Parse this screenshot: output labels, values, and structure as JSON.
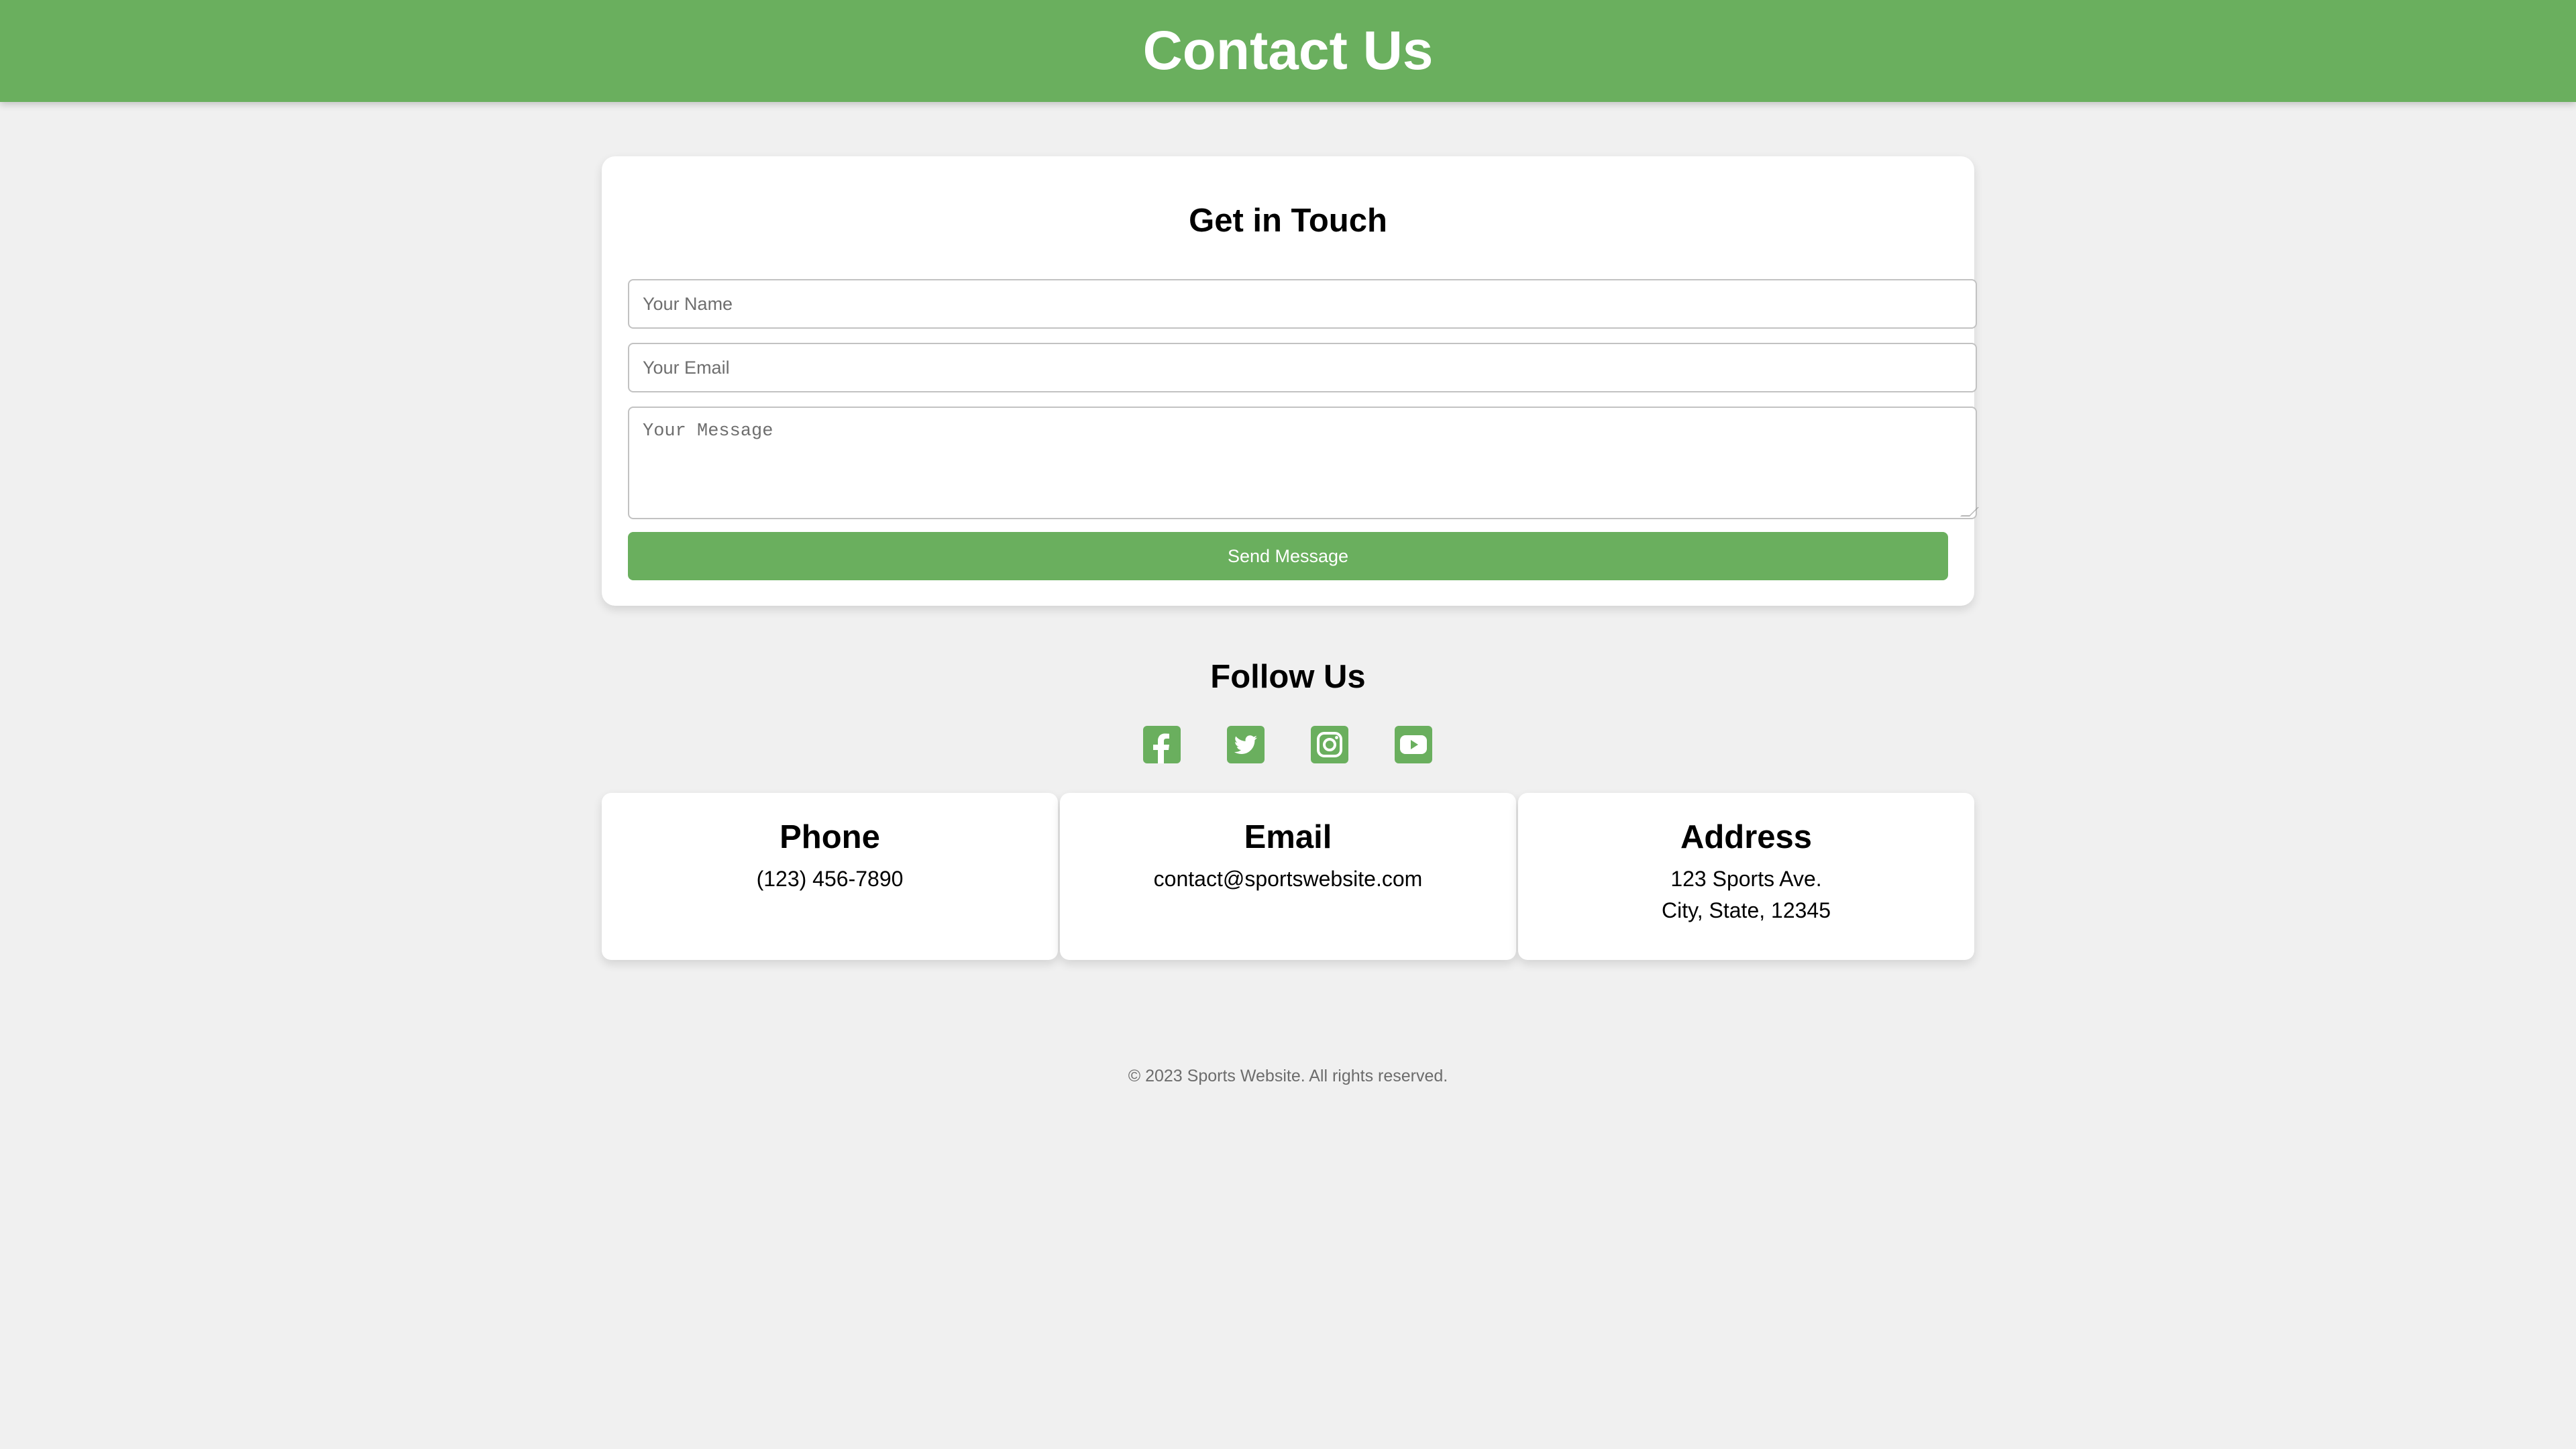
{
  "header": {
    "title": "Contact Us"
  },
  "form": {
    "title": "Get in Touch",
    "name_placeholder": "Your Name",
    "email_placeholder": "Your Email",
    "message_placeholder": "Your Message",
    "submit_label": "Send Message"
  },
  "follow": {
    "title": "Follow Us",
    "icons": [
      "facebook-icon",
      "twitter-icon",
      "instagram-icon",
      "youtube-icon"
    ]
  },
  "info": {
    "phone": {
      "title": "Phone",
      "value": "(123) 456-7890"
    },
    "email": {
      "title": "Email",
      "value": "contact@sportswebsite.com"
    },
    "address": {
      "title": "Address",
      "line1": "123 Sports Ave.",
      "line2": "City, State, 12345"
    }
  },
  "footer": {
    "text": "© 2023 Sports Website. All rights reserved."
  },
  "colors": {
    "brand_green": "#6aaf5e",
    "background": "#f0f0f0"
  }
}
